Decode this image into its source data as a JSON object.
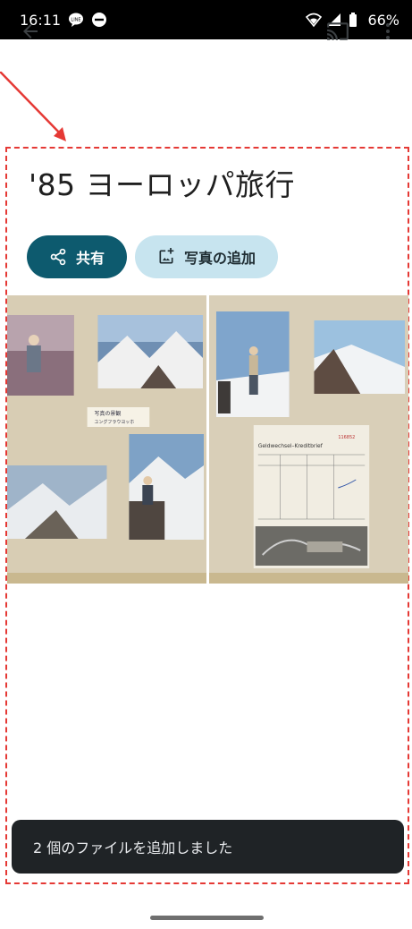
{
  "status_bar": {
    "time": "16:11",
    "battery": "66%",
    "icons": [
      "line-icon",
      "dnd-icon",
      "wifi-icon",
      "signal-icon",
      "battery-icon"
    ]
  },
  "app_bar": {
    "back_icon": "arrow-back-icon",
    "cast_icon": "cast-icon",
    "more_icon": "more-vert-icon"
  },
  "album": {
    "title": "'85 ヨーロッパ旅行"
  },
  "actions": {
    "share_label": "共有",
    "add_photos_label": "写真の追加"
  },
  "photos": [
    {
      "label": "album-page-left"
    },
    {
      "label": "album-page-right"
    }
  ],
  "album_details": {
    "left_page_caption": "写真の景観",
    "left_page_note": "ユングフラウヨッホ",
    "document_header": "Geldwechsel–Kreditbrief",
    "document_number": "116852"
  },
  "snackbar": {
    "message": "2 個のファイルを追加しました"
  },
  "colors": {
    "primary": "#0d5a6e",
    "secondary_container": "#c7e4ef",
    "annotation": "#e53935",
    "snackbar_bg": "#1f2326"
  }
}
